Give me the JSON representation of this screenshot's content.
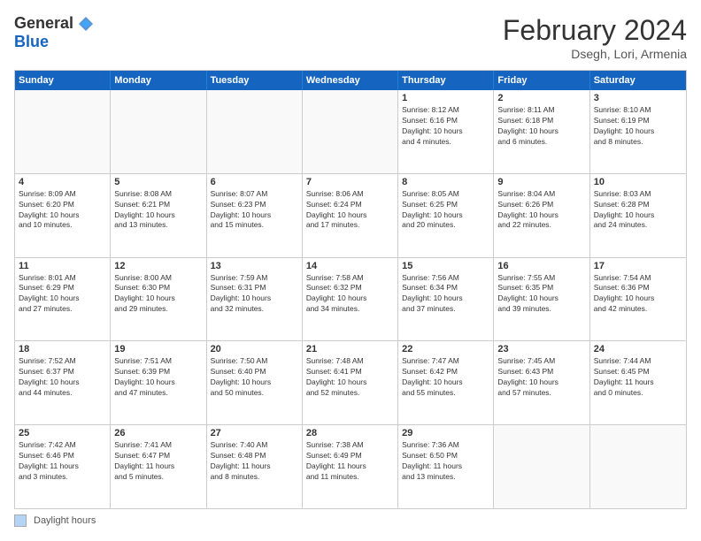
{
  "logo": {
    "general": "General",
    "blue": "Blue"
  },
  "title": "February 2024",
  "subtitle": "Dsegh, Lori, Armenia",
  "days_of_week": [
    "Sunday",
    "Monday",
    "Tuesday",
    "Wednesday",
    "Thursday",
    "Friday",
    "Saturday"
  ],
  "weeks": [
    [
      {
        "day": "",
        "info": ""
      },
      {
        "day": "",
        "info": ""
      },
      {
        "day": "",
        "info": ""
      },
      {
        "day": "",
        "info": ""
      },
      {
        "day": "1",
        "info": "Sunrise: 8:12 AM\nSunset: 6:16 PM\nDaylight: 10 hours\nand 4 minutes."
      },
      {
        "day": "2",
        "info": "Sunrise: 8:11 AM\nSunset: 6:18 PM\nDaylight: 10 hours\nand 6 minutes."
      },
      {
        "day": "3",
        "info": "Sunrise: 8:10 AM\nSunset: 6:19 PM\nDaylight: 10 hours\nand 8 minutes."
      }
    ],
    [
      {
        "day": "4",
        "info": "Sunrise: 8:09 AM\nSunset: 6:20 PM\nDaylight: 10 hours\nand 10 minutes."
      },
      {
        "day": "5",
        "info": "Sunrise: 8:08 AM\nSunset: 6:21 PM\nDaylight: 10 hours\nand 13 minutes."
      },
      {
        "day": "6",
        "info": "Sunrise: 8:07 AM\nSunset: 6:23 PM\nDaylight: 10 hours\nand 15 minutes."
      },
      {
        "day": "7",
        "info": "Sunrise: 8:06 AM\nSunset: 6:24 PM\nDaylight: 10 hours\nand 17 minutes."
      },
      {
        "day": "8",
        "info": "Sunrise: 8:05 AM\nSunset: 6:25 PM\nDaylight: 10 hours\nand 20 minutes."
      },
      {
        "day": "9",
        "info": "Sunrise: 8:04 AM\nSunset: 6:26 PM\nDaylight: 10 hours\nand 22 minutes."
      },
      {
        "day": "10",
        "info": "Sunrise: 8:03 AM\nSunset: 6:28 PM\nDaylight: 10 hours\nand 24 minutes."
      }
    ],
    [
      {
        "day": "11",
        "info": "Sunrise: 8:01 AM\nSunset: 6:29 PM\nDaylight: 10 hours\nand 27 minutes."
      },
      {
        "day": "12",
        "info": "Sunrise: 8:00 AM\nSunset: 6:30 PM\nDaylight: 10 hours\nand 29 minutes."
      },
      {
        "day": "13",
        "info": "Sunrise: 7:59 AM\nSunset: 6:31 PM\nDaylight: 10 hours\nand 32 minutes."
      },
      {
        "day": "14",
        "info": "Sunrise: 7:58 AM\nSunset: 6:32 PM\nDaylight: 10 hours\nand 34 minutes."
      },
      {
        "day": "15",
        "info": "Sunrise: 7:56 AM\nSunset: 6:34 PM\nDaylight: 10 hours\nand 37 minutes."
      },
      {
        "day": "16",
        "info": "Sunrise: 7:55 AM\nSunset: 6:35 PM\nDaylight: 10 hours\nand 39 minutes."
      },
      {
        "day": "17",
        "info": "Sunrise: 7:54 AM\nSunset: 6:36 PM\nDaylight: 10 hours\nand 42 minutes."
      }
    ],
    [
      {
        "day": "18",
        "info": "Sunrise: 7:52 AM\nSunset: 6:37 PM\nDaylight: 10 hours\nand 44 minutes."
      },
      {
        "day": "19",
        "info": "Sunrise: 7:51 AM\nSunset: 6:39 PM\nDaylight: 10 hours\nand 47 minutes."
      },
      {
        "day": "20",
        "info": "Sunrise: 7:50 AM\nSunset: 6:40 PM\nDaylight: 10 hours\nand 50 minutes."
      },
      {
        "day": "21",
        "info": "Sunrise: 7:48 AM\nSunset: 6:41 PM\nDaylight: 10 hours\nand 52 minutes."
      },
      {
        "day": "22",
        "info": "Sunrise: 7:47 AM\nSunset: 6:42 PM\nDaylight: 10 hours\nand 55 minutes."
      },
      {
        "day": "23",
        "info": "Sunrise: 7:45 AM\nSunset: 6:43 PM\nDaylight: 10 hours\nand 57 minutes."
      },
      {
        "day": "24",
        "info": "Sunrise: 7:44 AM\nSunset: 6:45 PM\nDaylight: 11 hours\nand 0 minutes."
      }
    ],
    [
      {
        "day": "25",
        "info": "Sunrise: 7:42 AM\nSunset: 6:46 PM\nDaylight: 11 hours\nand 3 minutes."
      },
      {
        "day": "26",
        "info": "Sunrise: 7:41 AM\nSunset: 6:47 PM\nDaylight: 11 hours\nand 5 minutes."
      },
      {
        "day": "27",
        "info": "Sunrise: 7:40 AM\nSunset: 6:48 PM\nDaylight: 11 hours\nand 8 minutes."
      },
      {
        "day": "28",
        "info": "Sunrise: 7:38 AM\nSunset: 6:49 PM\nDaylight: 11 hours\nand 11 minutes."
      },
      {
        "day": "29",
        "info": "Sunrise: 7:36 AM\nSunset: 6:50 PM\nDaylight: 11 hours\nand 13 minutes."
      },
      {
        "day": "",
        "info": ""
      },
      {
        "day": "",
        "info": ""
      }
    ]
  ],
  "footer": {
    "legend_label": "Daylight hours"
  }
}
